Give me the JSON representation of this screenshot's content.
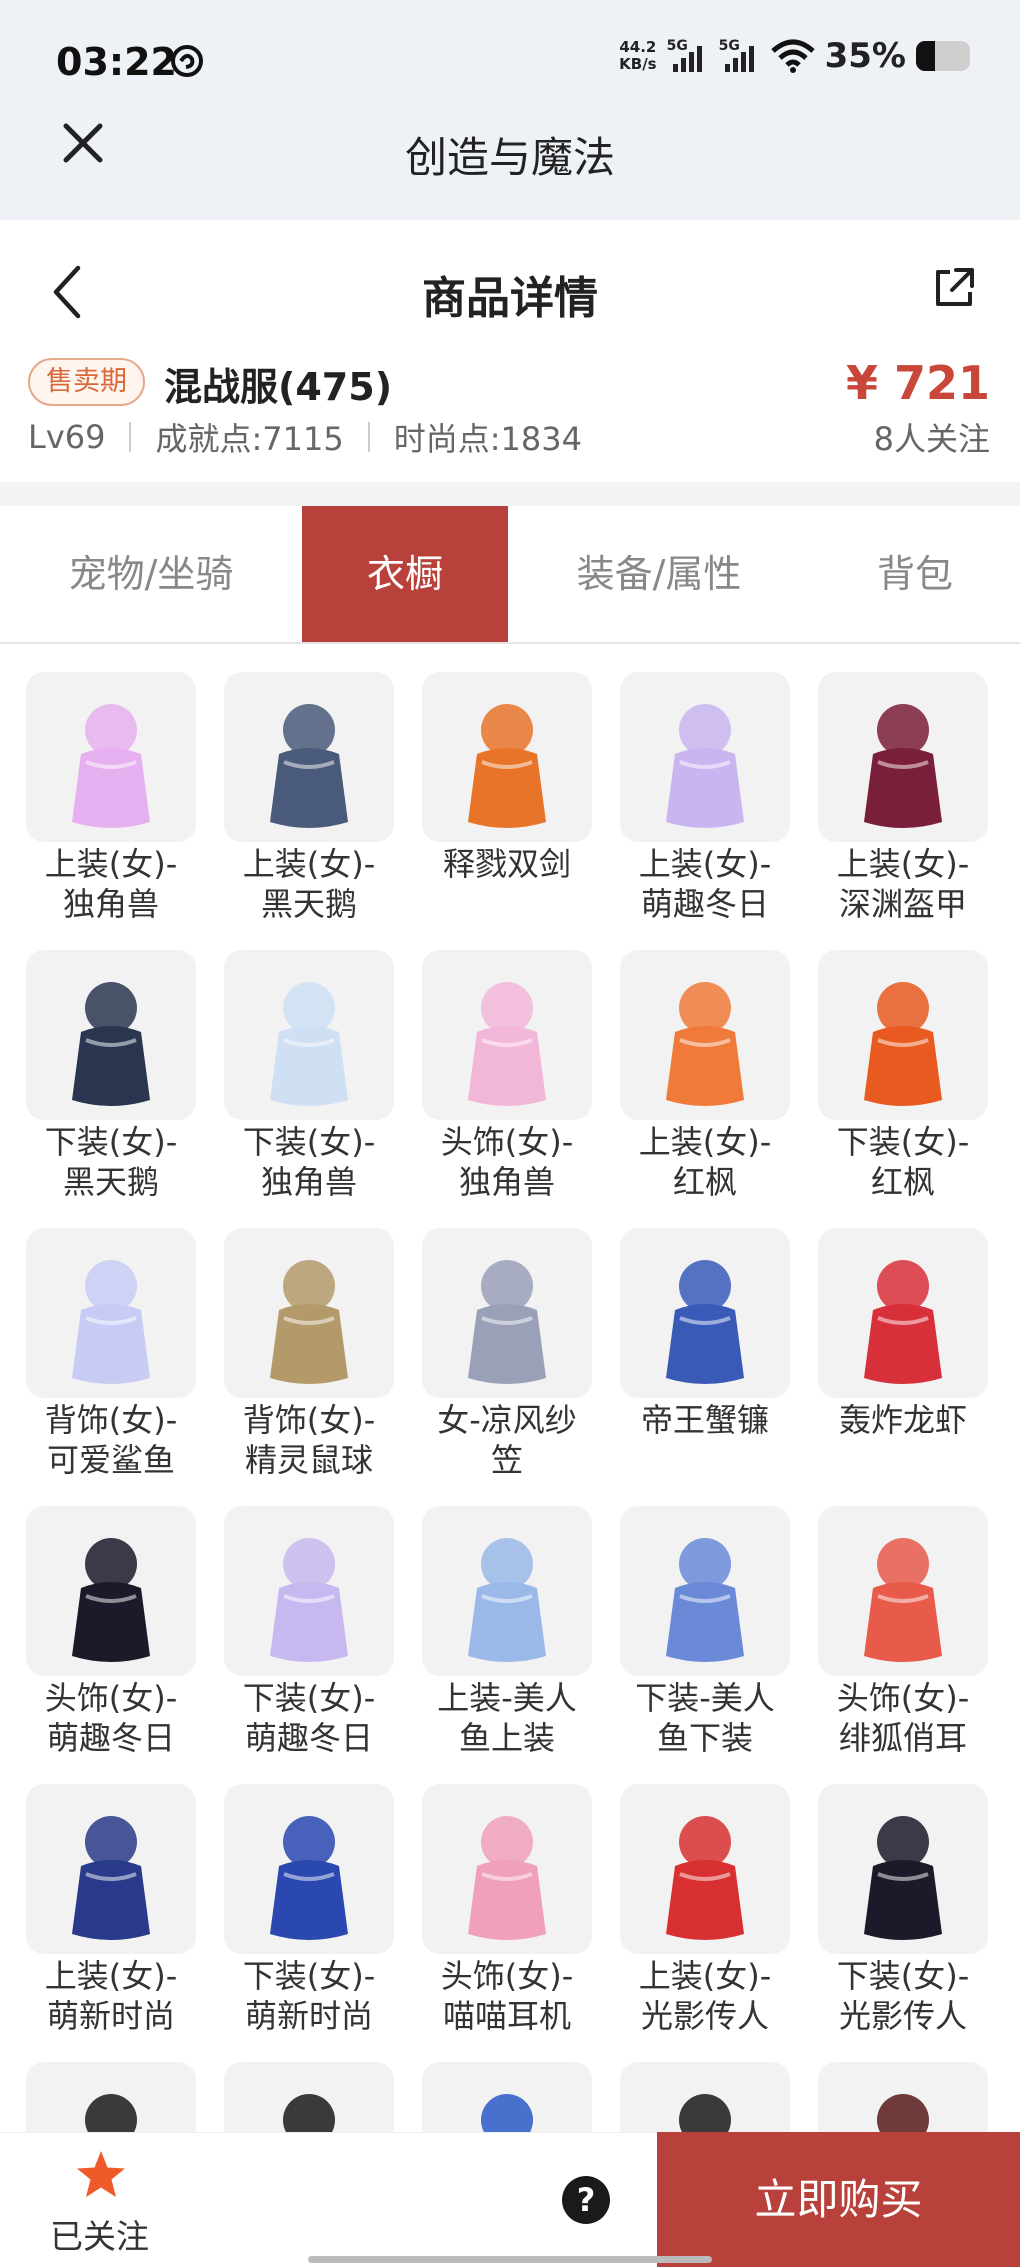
{
  "status_bar": {
    "time": "03:22",
    "net_speed_value": "44.2",
    "net_speed_unit": "KB/s",
    "sim1": "5G",
    "sim2": "5G",
    "battery_percent": "35%",
    "battery_level": 0.35
  },
  "app_nav": {
    "title": "创造与魔法",
    "close_icon": "close-icon"
  },
  "page_header": {
    "title": "商品详情",
    "back_icon": "chevron-left-icon",
    "share_icon": "share-icon"
  },
  "product": {
    "badge": "售卖期",
    "name": "混战服(475)",
    "price": "¥ 721",
    "level": "Lv69",
    "achievement": "成就点:7115",
    "fashion": "时尚点:1834",
    "followers": "8人关注"
  },
  "tabs": [
    {
      "label": "宠物/坐骑",
      "active": false
    },
    {
      "label": "衣橱",
      "active": true
    },
    {
      "label": "装备/属性",
      "active": false
    },
    {
      "label": "背包",
      "active": false
    }
  ],
  "items": [
    {
      "label": "上装(女)-\n独角兽",
      "icon": "unicorn-top-icon",
      "color": "#e6b0f0"
    },
    {
      "label": "上装(女)-\n黑天鹅",
      "icon": "black-swan-dress-icon",
      "color": "#4a5a7a"
    },
    {
      "label": "释戮双剑",
      "icon": "twin-swords-icon",
      "color": "#e8742a"
    },
    {
      "label": "上装(女)-\n萌趣冬日",
      "icon": "winter-top-icon",
      "color": "#c9b6f0"
    },
    {
      "label": "上装(女)-\n深渊盔甲",
      "icon": "abyss-armor-icon",
      "color": "#7a1f3a"
    },
    {
      "label": "下装(女)-\n黑天鹅",
      "icon": "black-heels-icon",
      "color": "#2a3650"
    },
    {
      "label": "下装(女)-\n独角兽",
      "icon": "unicorn-boots-icon",
      "color": "#cfe0f5"
    },
    {
      "label": "头饰(女)-\n独角兽",
      "icon": "unicorn-hood-icon",
      "color": "#f2b6d8"
    },
    {
      "label": "上装(女)-\n红枫",
      "icon": "maple-top-icon",
      "color": "#f07a3a"
    },
    {
      "label": "下装(女)-\n红枫",
      "icon": "maple-skirt-icon",
      "color": "#e85a20"
    },
    {
      "label": "背饰(女)-\n可爱鲨鱼",
      "icon": "shark-backpack-icon",
      "color": "#c8ccf5"
    },
    {
      "label": "背饰(女)-\n精灵鼠球",
      "icon": "mouse-ball-icon",
      "color": "#b49a6a"
    },
    {
      "label": "女-凉风纱\n笠",
      "icon": "veil-hat-icon",
      "color": "#9aa0b8"
    },
    {
      "label": "帝王蟹镰",
      "icon": "crab-scythe-icon",
      "color": "#3a5ab8"
    },
    {
      "label": "轰炸龙虾",
      "icon": "lobster-icon",
      "color": "#d8303a"
    },
    {
      "label": "头饰(女)-\n萌趣冬日",
      "icon": "winter-hair-icon",
      "color": "#1a1a2a"
    },
    {
      "label": "下装(女)-\n萌趣冬日",
      "icon": "winter-pants-icon",
      "color": "#c8b8f0"
    },
    {
      "label": "上装-美人\n鱼上装",
      "icon": "mermaid-top-icon",
      "color": "#9ab8e8"
    },
    {
      "label": "下装-美人\n鱼下装",
      "icon": "mermaid-skirt-icon",
      "color": "#6a8ad8"
    },
    {
      "label": "头饰(女)-\n绯狐俏耳",
      "icon": "fox-ears-icon",
      "color": "#e85a4a"
    },
    {
      "label": "上装(女)-\n萌新时尚",
      "icon": "fashion-top-icon",
      "color": "#2a3a8a"
    },
    {
      "label": "下装(女)-\n萌新时尚",
      "icon": "fashion-pants-icon",
      "color": "#2a48b0"
    },
    {
      "label": "头饰(女)-\n喵喵耳机",
      "icon": "cat-headphones-icon",
      "color": "#f0a0b8"
    },
    {
      "label": "上装(女)-\n光影传人",
      "icon": "light-jacket-icon",
      "color": "#d83030"
    },
    {
      "label": "下装(女)-\n光影传人",
      "icon": "pleated-skirt-icon",
      "color": "#1a1a2a"
    },
    {
      "label": "",
      "icon": "partial-top-icon",
      "color": "#1a1a1a"
    },
    {
      "label": "",
      "icon": "partial-skirt-icon",
      "color": "#1a1a1a"
    },
    {
      "label": "",
      "icon": "partial-blue-icon",
      "color": "#2a5ac8"
    },
    {
      "label": "",
      "icon": "partial-hair-icon",
      "color": "#1a1a1a"
    },
    {
      "label": "",
      "icon": "partial-hat-icon",
      "color": "#5a1a1a"
    }
  ],
  "bottom_bar": {
    "follow_label": "已关注",
    "help_symbol": "?",
    "buy_label": "立即购买",
    "accent": "#b8423b",
    "star_color": "#ef5a2a"
  }
}
